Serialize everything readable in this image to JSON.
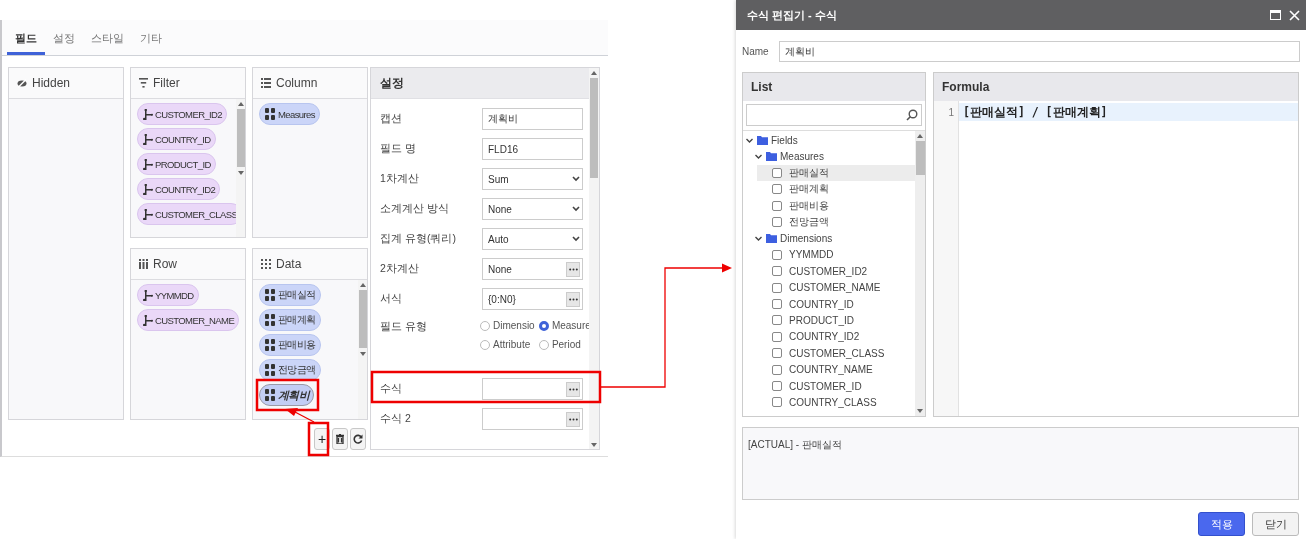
{
  "field_panel": {
    "tabs": [
      {
        "label": "필드",
        "selected": true
      },
      {
        "label": "설정",
        "selected": false
      },
      {
        "label": "스타일",
        "selected": false
      },
      {
        "label": "기타",
        "selected": false
      }
    ],
    "zones": [
      {
        "kind": "hidden",
        "title": "Hidden"
      },
      {
        "kind": "filter",
        "title": "Filter",
        "chips": [
          {
            "kind": "dimension",
            "label": "CUSTOMER_ID2",
            "selected": false
          },
          {
            "kind": "dimension",
            "label": "COUNTRY_ID",
            "selected": false
          },
          {
            "kind": "dimension",
            "label": "PRODUCT_ID",
            "selected": false
          },
          {
            "kind": "dimension",
            "label": "COUNTRY_ID2",
            "selected": false
          },
          {
            "kind": "dimension",
            "label": "CUSTOMER_CLASS",
            "selected": false
          }
        ]
      },
      {
        "kind": "column",
        "title": "Column",
        "chips": [
          {
            "kind": "measure",
            "label": "Measures",
            "selected": false
          }
        ]
      },
      {
        "kind": "row",
        "title": "Row",
        "chips": [
          {
            "kind": "dimension",
            "label": "YYMMDD",
            "selected": false
          },
          {
            "kind": "dimension",
            "label": "CUSTOMER_NAME",
            "selected": false
          }
        ]
      },
      {
        "kind": "data",
        "title": "Data",
        "chips": [
          {
            "kind": "measure",
            "label": "판매실적",
            "selected": false
          },
          {
            "kind": "measure",
            "label": "판매계획",
            "selected": false
          },
          {
            "kind": "measure",
            "label": "판매비용",
            "selected": false
          },
          {
            "kind": "measure",
            "label": "전망금액",
            "selected": false
          },
          {
            "kind": "measure",
            "label": "계획비",
            "selected": true
          }
        ]
      }
    ],
    "toolbar": [
      {
        "kind": "add",
        "label": "+"
      },
      {
        "kind": "delete"
      },
      {
        "kind": "refresh"
      }
    ],
    "settings": {
      "title": "설정",
      "rows": [
        {
          "kind": "text",
          "label": "캡션",
          "value": "계획비"
        },
        {
          "kind": "text",
          "label": "필드 명",
          "value": "FLD16"
        },
        {
          "kind": "select",
          "label": "1차계산",
          "value": "Sum"
        },
        {
          "kind": "select",
          "label": "소계계산 방식",
          "value": "None"
        },
        {
          "kind": "select",
          "label": "집계 유형(쿼리)",
          "value": "Auto"
        },
        {
          "kind": "picker",
          "label": "2차계산",
          "value": "None"
        },
        {
          "kind": "picker",
          "label": "서식",
          "value": "{0:N0}"
        },
        {
          "kind": "radio",
          "label": "필드 유형",
          "options": [
            {
              "label": "Dimensio",
              "selected": false
            },
            {
              "label": "Measure",
              "selected": true
            },
            {
              "label": "Attribute",
              "selected": false
            },
            {
              "label": "Period",
              "selected": false
            }
          ]
        },
        {
          "kind": "picker",
          "label": "수식"
        },
        {
          "kind": "picker",
          "label": "수식 2"
        }
      ]
    }
  },
  "dialog": {
    "title": "수식 편집기 - 수식",
    "name_label": "Name",
    "name_value": "계획비",
    "list": {
      "title": "List",
      "tree": [
        {
          "label": "Fields",
          "expanded": true,
          "children": [
            {
              "label": "Measures",
              "expanded": true,
              "children": [
                {
                  "label": "판매실적",
                  "checked": false,
                  "selected": true
                },
                {
                  "label": "판매계획",
                  "checked": false,
                  "selected": false
                },
                {
                  "label": "판매비용",
                  "checked": false,
                  "selected": false
                },
                {
                  "label": "전망금액",
                  "checked": false,
                  "selected": false
                }
              ]
            },
            {
              "label": "Dimensions",
              "expanded": true,
              "children": [
                {
                  "label": "YYMMDD",
                  "checked": false,
                  "selected": false
                },
                {
                  "label": "CUSTOMER_ID2",
                  "checked": false,
                  "selected": false
                },
                {
                  "label": "CUSTOMER_NAME",
                  "checked": false,
                  "selected": false
                },
                {
                  "label": "COUNTRY_ID",
                  "checked": false,
                  "selected": false
                },
                {
                  "label": "PRODUCT_ID",
                  "checked": false,
                  "selected": false
                },
                {
                  "label": "COUNTRY_ID2",
                  "checked": false,
                  "selected": false
                },
                {
                  "label": "CUSTOMER_CLASS",
                  "checked": false,
                  "selected": false
                },
                {
                  "label": "COUNTRY_NAME",
                  "checked": false,
                  "selected": false
                },
                {
                  "label": "CUSTOMER_ID",
                  "checked": false,
                  "selected": false
                },
                {
                  "label": "COUNTRY_CLASS",
                  "checked": false,
                  "selected": false
                }
              ]
            }
          ]
        }
      ]
    },
    "formula": {
      "title": "Formula",
      "lines": [
        {
          "number": "1",
          "text": "[판매실적] / [판매계획]"
        }
      ]
    },
    "description": "[ACTUAL] - 판매실적",
    "buttons": [
      {
        "kind": "primary",
        "label": "적용"
      },
      {
        "kind": "secondary",
        "label": "닫기"
      }
    ]
  }
}
